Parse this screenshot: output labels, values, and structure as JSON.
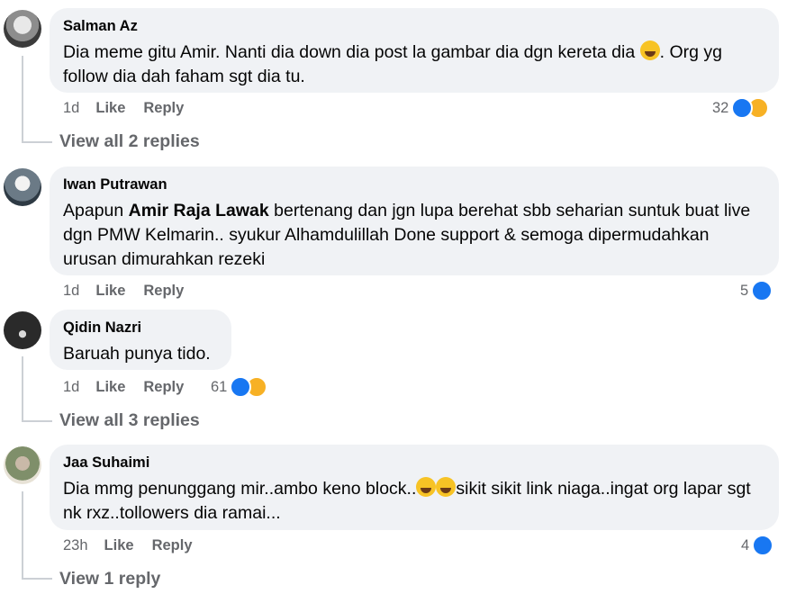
{
  "comments": [
    {
      "author": "Salman Az",
      "text_parts": [
        "Dia meme gitu Amir. Nanti dia down dia post la gambar dia dgn kereta dia ",
        ". Org yg follow dia dah faham sgt dia tu."
      ],
      "time": "1d",
      "like_label": "Like",
      "reply_label": "Reply",
      "reaction_count": "32",
      "replies_label": "View all 2 replies"
    },
    {
      "author": "Iwan Putrawan",
      "text_pre": "Apapun ",
      "mention": "Amir Raja Lawak",
      "text_post": " bertenang dan jgn lupa berehat sbb seharian suntuk buat live dgn PMW Kelmarin.. syukur Alhamdulillah Done support & semoga dipermudahkan urusan dimurahkan rezeki",
      "time": "1d",
      "like_label": "Like",
      "reply_label": "Reply",
      "reaction_count": "5"
    },
    {
      "author": "Qidin Nazri",
      "text": "Baruah punya tido.",
      "time": "1d",
      "like_label": "Like",
      "reply_label": "Reply",
      "reaction_count": "61",
      "replies_label": "View all 3 replies"
    },
    {
      "author": "Jaa Suhaimi",
      "text_parts": [
        "Dia mmg penunggang mir..ambo keno block..",
        "sikit sikit link niaga..ingat org lapar sgt nk rxz..tollowers dia ramai..."
      ],
      "time": "23h",
      "like_label": "Like",
      "reply_label": "Reply",
      "reaction_count": "4",
      "replies_label": "View 1 reply"
    }
  ],
  "icons": {
    "like": "like-reaction-icon",
    "haha": "haha-reaction-icon",
    "emoji": "laughing-emoji-icon"
  },
  "colors": {
    "bubble": "#f0f2f5",
    "like_blue": "#1877f2",
    "meta_gray": "#65676b"
  }
}
